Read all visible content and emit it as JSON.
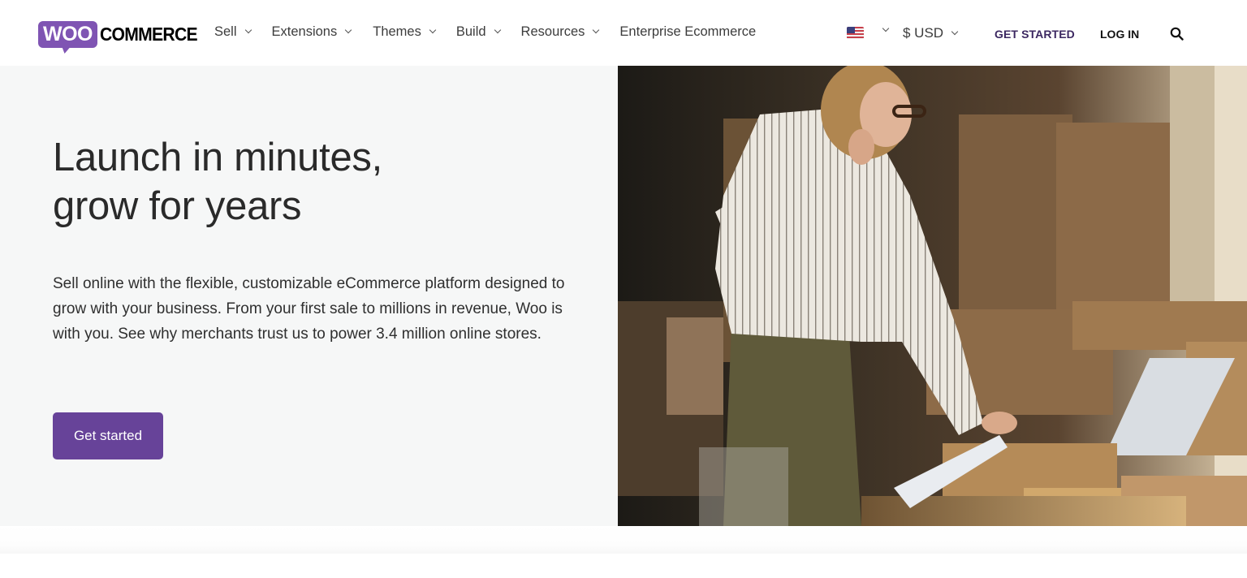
{
  "brand": {
    "logo_woo": "WOO",
    "logo_commerce": "COMMERCE",
    "accent_color": "#7f54b3",
    "button_color": "#674399"
  },
  "nav": {
    "items": [
      {
        "label": "Sell",
        "has_dropdown": true
      },
      {
        "label": "Extensions",
        "has_dropdown": true
      },
      {
        "label": "Themes",
        "has_dropdown": true
      },
      {
        "label": "Build",
        "has_dropdown": true
      },
      {
        "label": "Resources",
        "has_dropdown": true
      },
      {
        "label": "Enterprise Ecommerce",
        "has_dropdown": false
      }
    ],
    "region_icon": "us-flag-icon",
    "currency": "$ USD",
    "get_started": "GET STARTED",
    "login": "LOG IN",
    "search_icon": "search-icon"
  },
  "hero": {
    "title_line1": "Launch in minutes,",
    "title_line2": "grow for years",
    "description": "Sell online with the flexible, customizable eCommerce platform designed to grow with your business. From your first sale to millions in revenue, Woo is with you. See why merchants trust us to power 3.4 million online stores.",
    "cta_label": "Get started",
    "image_alt": "Woman on phone packing orders among cardboard boxes"
  }
}
